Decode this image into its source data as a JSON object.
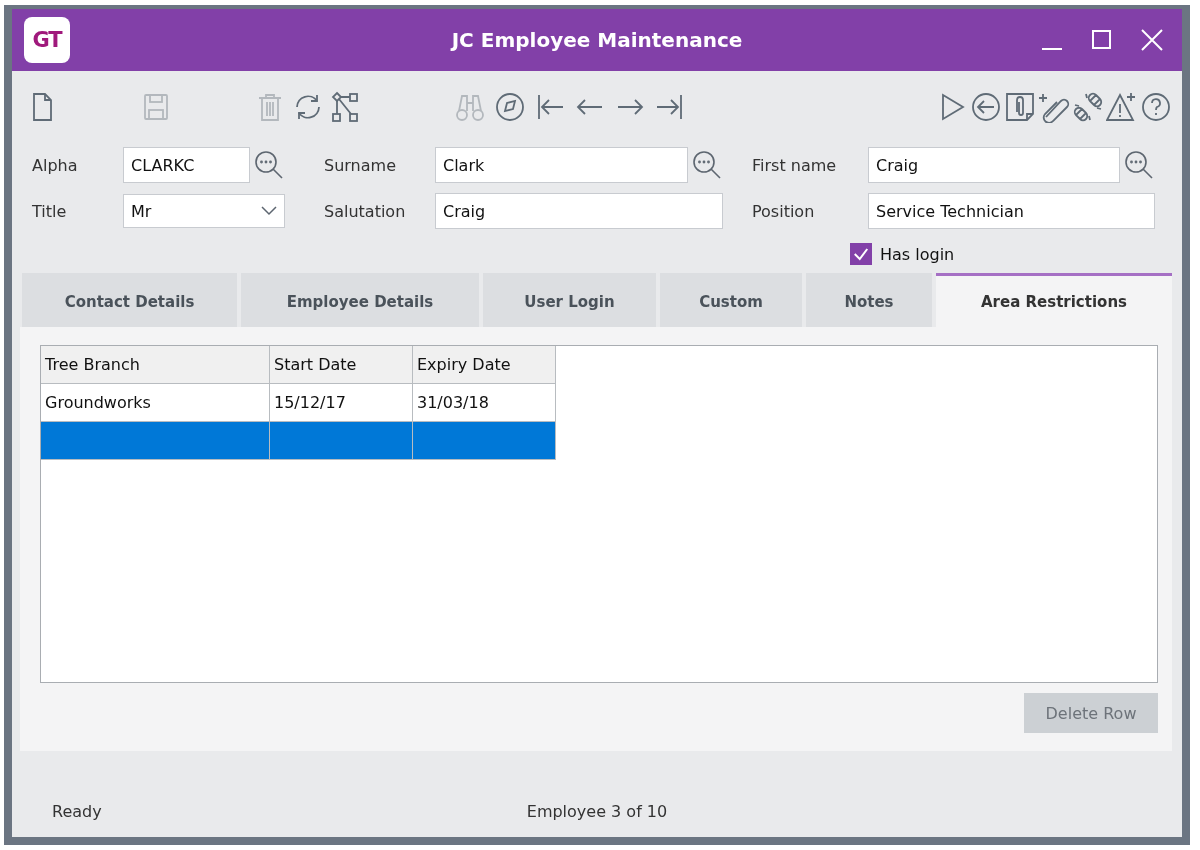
{
  "window": {
    "logo": "GT",
    "title": "JC Employee Maintenance"
  },
  "toolbar": {
    "left": [
      {
        "kind": "new",
        "disabled": false
      },
      {
        "kind": "gap"
      },
      {
        "kind": "save",
        "disabled": true
      },
      {
        "kind": "gap"
      },
      {
        "kind": "delete",
        "disabled": true
      },
      {
        "kind": "refresh",
        "disabled": false
      },
      {
        "kind": "workflow",
        "disabled": false
      }
    ],
    "center": [
      {
        "kind": "find",
        "disabled": true
      },
      {
        "kind": "compass",
        "disabled": false
      },
      {
        "kind": "first",
        "disabled": false
      },
      {
        "kind": "prev",
        "disabled": false
      },
      {
        "kind": "next",
        "disabled": false
      },
      {
        "kind": "last",
        "disabled": false
      }
    ],
    "right": [
      {
        "kind": "run",
        "disabled": false
      },
      {
        "kind": "back",
        "disabled": false
      },
      {
        "kind": "attachments",
        "disabled": false
      },
      {
        "kind": "attach",
        "disabled": false
      },
      {
        "kind": "unlink",
        "disabled": false
      },
      {
        "kind": "alert",
        "disabled": false
      },
      {
        "kind": "help",
        "disabled": false
      }
    ]
  },
  "fields": [
    {
      "label": "Alpha",
      "value": "CLARKC",
      "kind": "lookup"
    },
    {
      "label": "Surname",
      "value": "Clark",
      "kind": "lookup"
    },
    {
      "label": "First name",
      "value": "Craig",
      "kind": "lookup"
    },
    {
      "label": "Title",
      "value": "Mr",
      "kind": "select"
    },
    {
      "label": "Salutation",
      "value": "Craig",
      "kind": "text"
    },
    {
      "label": "Position",
      "value": "Service Technician",
      "kind": "text"
    }
  ],
  "has_login": {
    "label": "Has login",
    "checked": true
  },
  "tabs": [
    {
      "label": "Contact Details",
      "selected": false
    },
    {
      "label": "Employee Details",
      "selected": false
    },
    {
      "label": "User Login",
      "selected": false
    },
    {
      "label": "Custom",
      "selected": false
    },
    {
      "label": "Notes",
      "selected": false
    },
    {
      "label": "Area Restrictions",
      "selected": true
    }
  ],
  "table": {
    "columns": [
      "Tree Branch",
      "Start Date",
      "Expiry Date"
    ],
    "rows": [
      {
        "cells": [
          "Groundworks",
          "15/12/17",
          "31/03/18"
        ],
        "selected": false
      },
      {
        "selected": true
      }
    ]
  },
  "delete_button": {
    "label": "Delete Row",
    "disabled": true
  },
  "status_bar": {
    "left": "Ready",
    "center": "Employee 3 of 10"
  }
}
